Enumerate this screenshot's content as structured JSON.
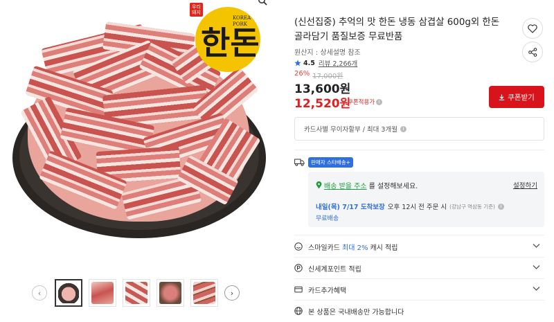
{
  "gallery": {
    "logo": {
      "tag_line1": "우리",
      "tag_line2": "돼지",
      "hangul": "한돈",
      "english_line1": "KOREA",
      "english_line2": "PORK"
    },
    "prev_arrow": "‹",
    "next_arrow": "›",
    "thumbnail_count": 5,
    "active_thumbnail": 1
  },
  "product": {
    "title": "(신선집중) 추억의 맛 한돈 냉동 삼겹살 600g외 한돈 골라담기 품질보증 무료반품",
    "origin": "원산지 : 상세설명 참조",
    "rating": "4.5",
    "review_label": "리뷰 2,266개",
    "discount_rate": "26%",
    "original_price": "17,000원",
    "price": "13,600원",
    "coupon_price": "12,520원",
    "coupon_price_label": "쿠폰적용가",
    "coupon_button": "쿠폰받기",
    "installment": "카드사별 무이자할부 / 최대 3개월"
  },
  "delivery": {
    "badge": "판매자 스타배송+",
    "address_link": "배송 받을 주소",
    "address_suffix": "를 설정해보세요.",
    "setting_link": "설정하기",
    "eta_date": "내일(목) 7/17 도착보장",
    "eta_condition": "오후 12시 전 주문 시",
    "eta_note": "(강남구 역삼동 기준)",
    "fee": "무료배송"
  },
  "benefits": [
    {
      "prefix": "스마일카드",
      "highlight": "최대 2%",
      "suffix": "캐시 적립"
    },
    {
      "prefix": "신세계포인트 적립",
      "highlight": "",
      "suffix": ""
    },
    {
      "prefix": "카드추가혜택",
      "highlight": "",
      "suffix": ""
    }
  ],
  "notice": "본 상품은 국내배송만 가능합니다",
  "colors": {
    "accent_red": "#d8131b",
    "price_red": "#e02020",
    "link_blue": "#2f6fe0",
    "link_green": "#1d9b3d",
    "logo_yellow": "#f5c400"
  }
}
